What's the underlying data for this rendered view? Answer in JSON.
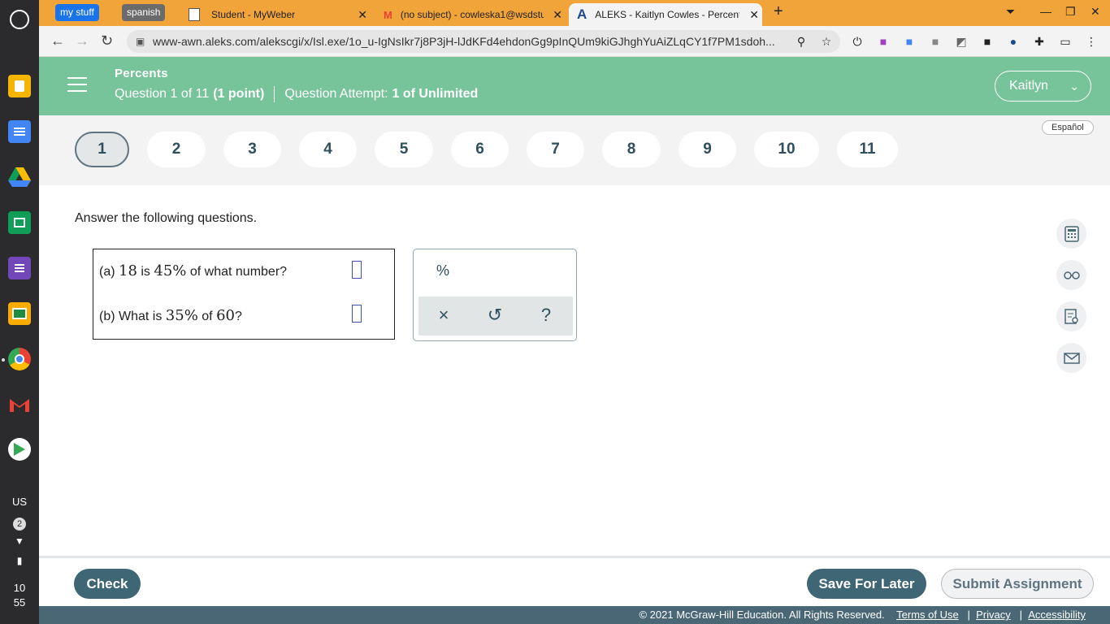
{
  "browser": {
    "bookmarks": [
      "my stuff",
      "spanish"
    ],
    "tabs": [
      {
        "title": "Student - MyWeber"
      },
      {
        "title": "(no subject) - cowleska1@wsdstu"
      },
      {
        "title": "ALEKS - Kaitlyn Cowles - Percents"
      }
    ],
    "url": "www-awn.aleks.com/alekscgi/x/Isl.exe/1o_u-IgNsIkr7j8P3jH-lJdKFd4ehdonGg9pInQUm9kiGJhghYuAiZLqCY1f7PM1sdoh..."
  },
  "shelf": {
    "locale": "US",
    "notification_count": "2",
    "time_hour": "10",
    "time_minute": "55"
  },
  "header": {
    "topic": "Percents",
    "question_progress_prefix": "Question 1 of 11",
    "question_points": "(1 point)",
    "attempt_label": "Question Attempt:",
    "attempt_value": "1 of Unlimited",
    "user_name": "Kaitlyn"
  },
  "question_nav": {
    "items": [
      "1",
      "2",
      "3",
      "4",
      "5",
      "6",
      "7",
      "8",
      "9",
      "10",
      "11"
    ],
    "active": 0,
    "language_link": "Español"
  },
  "content": {
    "instructions": "Answer the following questions.",
    "part_a": {
      "label": "(a)",
      "n1": "18",
      "text1": "is",
      "n2": "45%",
      "text2": "of what number?"
    },
    "part_b": {
      "label": "(b) What is",
      "n1": "35%",
      "text1": "of",
      "n2": "60",
      "text2": "?"
    }
  },
  "toolbox": {
    "percent": "%",
    "clear": "×",
    "undo": "↺",
    "help": "?"
  },
  "bottom": {
    "check": "Check",
    "save": "Save For Later",
    "submit": "Submit Assignment"
  },
  "footer": {
    "copyright": "© 2021 McGraw-Hill Education. All Rights Reserved.",
    "terms": "Terms of Use",
    "privacy": "Privacy",
    "accessibility": "Accessibility"
  },
  "colors": {
    "header": "#77c49a",
    "tabbar": "#f0a43a",
    "primary_button": "#3e6674",
    "footer": "#4a6775"
  }
}
